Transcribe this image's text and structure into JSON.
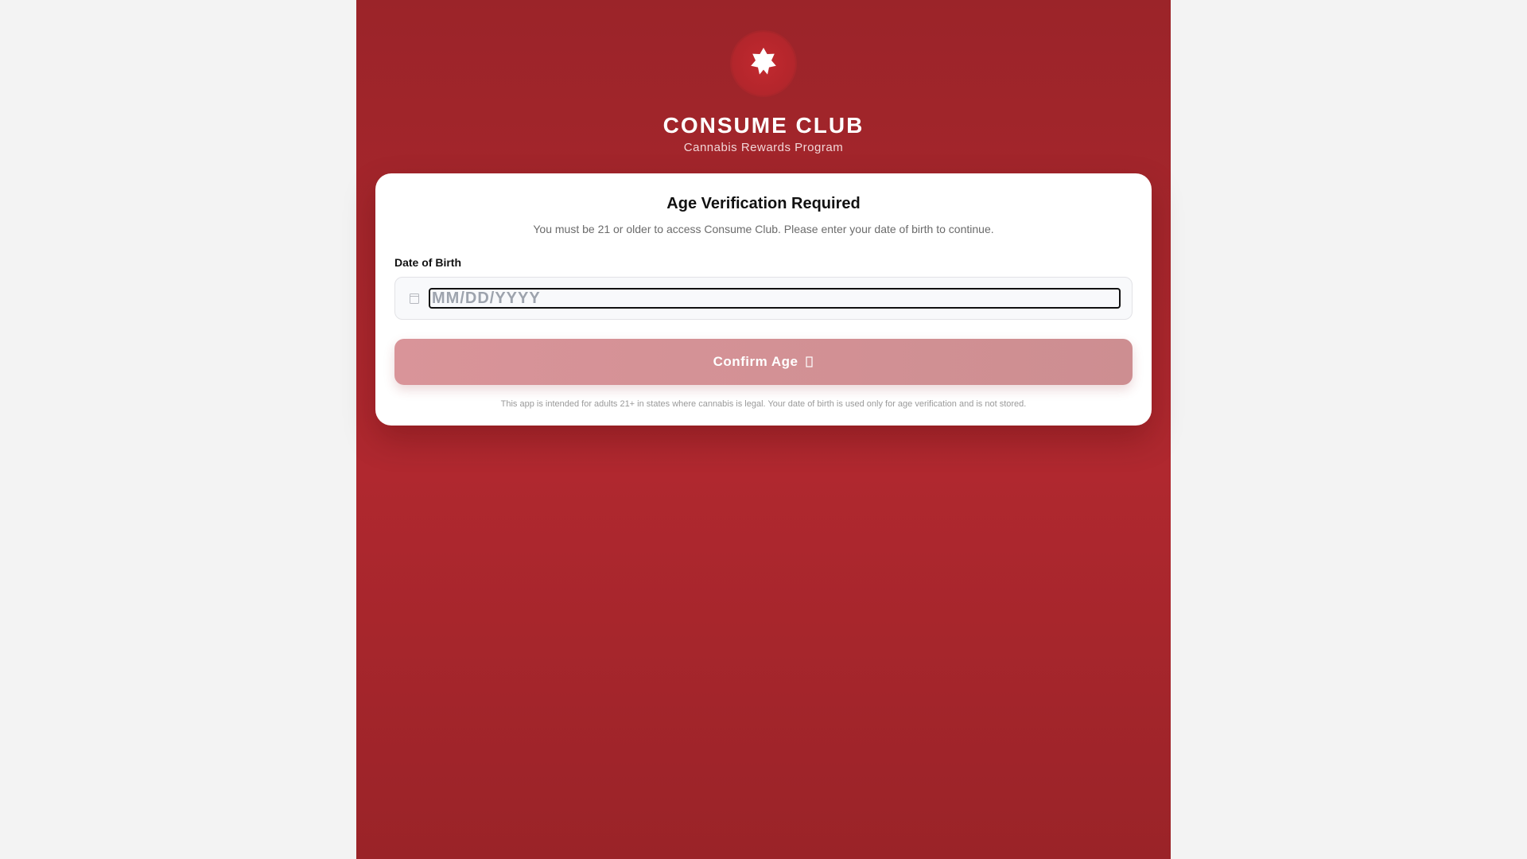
{
  "brand": {
    "logo_icon": "cannabis-leaf-icon",
    "title": "CONSUME CLUB",
    "subtitle": "Cannabis Rewards Program"
  },
  "card": {
    "title": "Age Verification Required",
    "description": "You must be 21 or older to access Consume Club. Please enter your date of birth to continue.",
    "dob_label": "Date of Birth",
    "dob_placeholder": "MM/DD/YYYY",
    "dob_value": "",
    "dob_icon": "calendar-icon",
    "confirm_label": "Confirm Age",
    "confirm_icon": "arrow-right-icon",
    "disclaimer": "This app is intended for adults 21+ in states where cannabis is legal. Your date of birth is used only for age verification and is not stored."
  },
  "colors": {
    "background_red": "#a8262c",
    "button_disabled": "#d49296",
    "page_background": "#f3f3f3"
  }
}
